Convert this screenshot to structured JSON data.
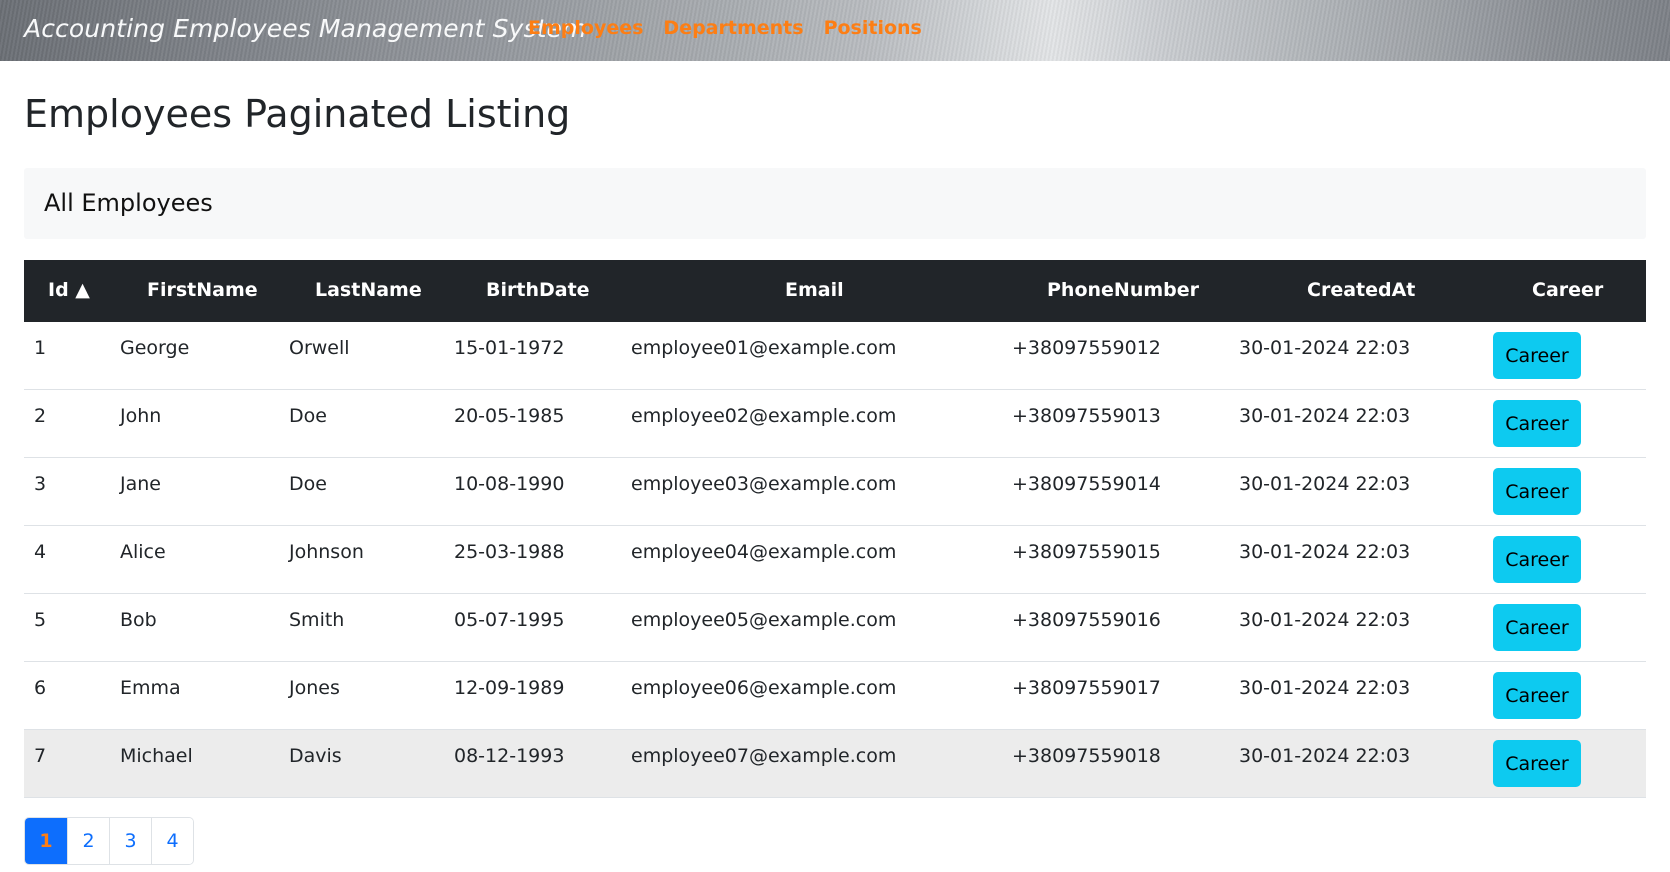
{
  "navbar": {
    "brand": "Accounting Employees Management System",
    "links": [
      "Employees",
      "Departments",
      "Positions"
    ]
  },
  "page_title": "Employees Paginated Listing",
  "card_header": "All Employees",
  "table": {
    "headers": {
      "id": "Id ▲",
      "first": "FirstName",
      "last": "LastName",
      "birth": "BirthDate",
      "email": "Email",
      "phone": "PhoneNumber",
      "created": "CreatedAt",
      "career": "Career"
    },
    "rows": [
      {
        "id": "1",
        "first": "George",
        "last": "Orwell",
        "birth": "15-01-1972",
        "email": "employee01@example.com",
        "phone": "+38097559012",
        "created": "30-01-2024 22:03",
        "career": "Career"
      },
      {
        "id": "2",
        "first": "John",
        "last": "Doe",
        "birth": "20-05-1985",
        "email": "employee02@example.com",
        "phone": "+38097559013",
        "created": "30-01-2024 22:03",
        "career": "Career"
      },
      {
        "id": "3",
        "first": "Jane",
        "last": "Doe",
        "birth": "10-08-1990",
        "email": "employee03@example.com",
        "phone": "+38097559014",
        "created": "30-01-2024 22:03",
        "career": "Career"
      },
      {
        "id": "4",
        "first": "Alice",
        "last": "Johnson",
        "birth": "25-03-1988",
        "email": "employee04@example.com",
        "phone": "+38097559015",
        "created": "30-01-2024 22:03",
        "career": "Career"
      },
      {
        "id": "5",
        "first": "Bob",
        "last": "Smith",
        "birth": "05-07-1995",
        "email": "employee05@example.com",
        "phone": "+38097559016",
        "created": "30-01-2024 22:03",
        "career": "Career"
      },
      {
        "id": "6",
        "first": "Emma",
        "last": "Jones",
        "birth": "12-09-1989",
        "email": "employee06@example.com",
        "phone": "+38097559017",
        "created": "30-01-2024 22:03",
        "career": "Career"
      },
      {
        "id": "7",
        "first": "Michael",
        "last": "Davis",
        "birth": "08-12-1993",
        "email": "employee07@example.com",
        "phone": "+38097559018",
        "created": "30-01-2024 22:03",
        "career": "Career"
      }
    ]
  },
  "pagination": {
    "pages": [
      "1",
      "2",
      "3",
      "4"
    ],
    "current": "1"
  },
  "colors": {
    "nav_link": "#fd7e14",
    "table_header_bg": "#212529",
    "career_button": "#0dcaf0",
    "page_active_bg": "#0d6efd"
  }
}
